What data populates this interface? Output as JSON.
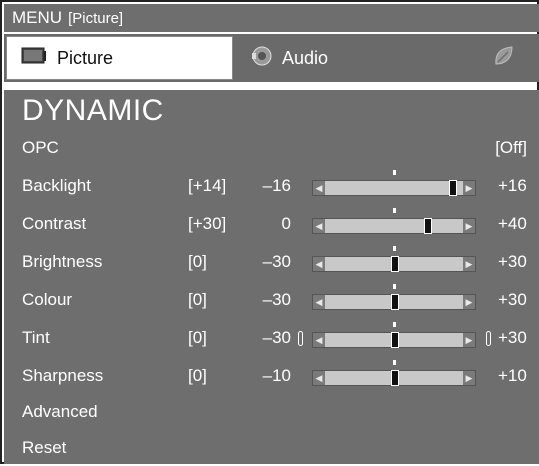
{
  "header": {
    "menu_label": "MENU",
    "section": "[Picture]"
  },
  "tabs": [
    {
      "label": "Picture",
      "icon": "tv-icon",
      "active": true
    },
    {
      "label": "Audio",
      "icon": "speaker-icon",
      "active": false
    },
    {
      "label": "",
      "icon": "leaf-icon",
      "active": false
    }
  ],
  "panel": {
    "mode": "DYNAMIC",
    "opc": {
      "label": "OPC",
      "value": "[Off]"
    },
    "sliders": [
      {
        "label": "Backlight",
        "value": "[+14]",
        "min": "–16",
        "max": "+16",
        "level": 0.9375
      },
      {
        "label": "Contrast",
        "value": "[+30]",
        "min": "0",
        "max": "+40",
        "level": 0.75
      },
      {
        "label": "Brightness",
        "value": "[0]",
        "min": "–30",
        "max": "+30",
        "level": 0.5
      },
      {
        "label": "Colour",
        "value": "[0]",
        "min": "–30",
        "max": "+30",
        "level": 0.5
      },
      {
        "label": "Tint",
        "value": "[0]",
        "min": "–30",
        "max": "+30",
        "level": 0.5,
        "brackets": true
      },
      {
        "label": "Sharpness",
        "value": "[0]",
        "min": "–10",
        "max": "+10",
        "level": 0.5
      }
    ],
    "advanced": "Advanced",
    "reset": "Reset"
  },
  "colors": {
    "panel_bg": "#6e6e6e",
    "bar_bg": "#c8c8c8",
    "thumb": "#111111"
  }
}
